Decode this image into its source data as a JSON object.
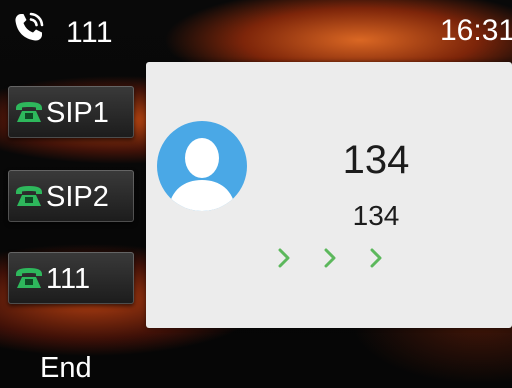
{
  "status_bar": {
    "account": "111",
    "time": "16:31"
  },
  "line_keys": [
    {
      "label": "SIP1",
      "icon": "phone-icon",
      "icon_color": "#2eb85c"
    },
    {
      "label": "SIP2",
      "icon": "phone-icon",
      "icon_color": "#2eb85c"
    },
    {
      "label": "111",
      "icon": "phone-icon",
      "icon_color": "#2eb85c"
    }
  ],
  "call": {
    "name": "134",
    "number": "134",
    "avatar_color": "#4aa8e6",
    "progress_color": "#5cb85c"
  },
  "softkeys": [
    {
      "label": "End"
    }
  ]
}
